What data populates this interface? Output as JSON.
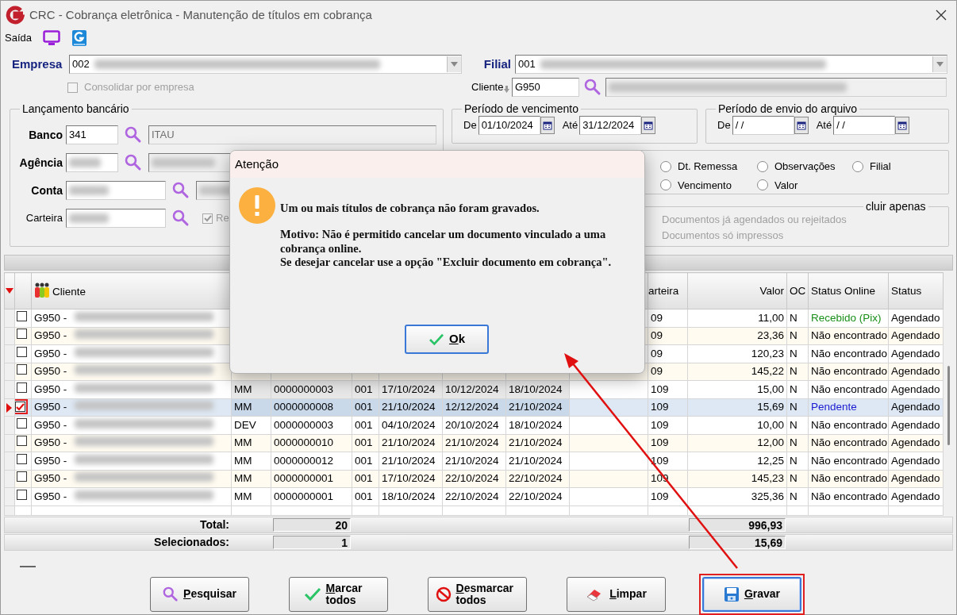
{
  "window": {
    "title": "CRC - Cobrança eletrônica - Manutenção de títulos em cobrança"
  },
  "toolbar": {
    "label": "Saída"
  },
  "empresa": {
    "label": "Empresa",
    "value": "002",
    "redacted": true
  },
  "filial": {
    "label": "Filial",
    "value": "001",
    "redacted": true
  },
  "consolidar": {
    "label": "Consolidar por empresa",
    "checked": false,
    "disabled": true
  },
  "cliente": {
    "label": "Cliente",
    "value": "G950",
    "redacted": true
  },
  "lancamento": {
    "title": "Lançamento bancário",
    "fields": [
      {
        "label": "Banco",
        "required": true,
        "value": "341",
        "description": "ITAU",
        "kind": "short"
      },
      {
        "label": "Agência",
        "required": true,
        "redacted": true,
        "kind": "short"
      },
      {
        "label": "Conta",
        "required": true,
        "redacted": true,
        "kind": "long"
      },
      {
        "label": "Carteira",
        "required": false,
        "redacted": true,
        "kind": "check",
        "check_label": "Re",
        "checked": true
      }
    ]
  },
  "vencimento": {
    "title": "Período de vencimento",
    "from_label": "De",
    "from": "01/10/2024",
    "to_label": "Até",
    "to": "31/12/2024"
  },
  "envio": {
    "title": "Período de envio do arquivo",
    "from_label": "De",
    "from": "/ /",
    "to_label": "Até",
    "to": "/ /"
  },
  "ordenacao": {
    "options": [
      {
        "label": "Dt. Remessa",
        "selected": false
      },
      {
        "label": "Observações",
        "selected": false
      },
      {
        "label": "Filial",
        "selected": false
      },
      {
        "label": "Vencimento",
        "selected": false
      },
      {
        "label": "Valor",
        "selected": false
      }
    ]
  },
  "incluir": {
    "title": "cluir apenas",
    "options": [
      {
        "label": "Documentos já agendados ou rejeitados",
        "disabled": true
      },
      {
        "label": "Documentos só impressos",
        "disabled": true
      }
    ]
  },
  "table": {
    "columns": [
      "",
      "",
      "Cliente",
      "",
      "",
      "",
      "",
      "",
      "",
      "",
      "arteira",
      "Valor",
      "OC",
      "Status Online",
      "Status"
    ],
    "client_redacted": true,
    "rows": [
      {
        "checked": false,
        "selected": false,
        "cliente": "G950 -",
        "carteira": "09",
        "valor": "11,00",
        "oc": "N",
        "status_online": "Recebido (Pix)",
        "color": "#1a8f1a",
        "status": "Agendado"
      },
      {
        "checked": false,
        "selected": false,
        "cliente": "G950 -",
        "carteira": "09",
        "valor": "23,36",
        "oc": "N",
        "status_online": "Não encontrado",
        "color": "#000000",
        "status": "Agendado"
      },
      {
        "checked": false,
        "selected": false,
        "cliente": "G950 -",
        "carteira": "09",
        "valor": "120,23",
        "oc": "N",
        "status_online": "Não encontrado",
        "color": "#000000",
        "status": "Agendado"
      },
      {
        "checked": false,
        "selected": false,
        "cliente": "G950 -",
        "carteira": "09",
        "valor": "145,22",
        "oc": "N",
        "status_online": "Não encontrado",
        "color": "#000000",
        "status": "Agendado"
      },
      {
        "checked": false,
        "selected": false,
        "cliente": "G950 -",
        "tipo": "MM",
        "documento": "0000000003",
        "filial": "001",
        "data_1": "17/10/2024",
        "data_2": "10/12/2024",
        "data_3": "18/10/2024",
        "carteira": "109",
        "valor": "15,00",
        "oc": "N",
        "status_online": "Não encontrado",
        "color": "#000000",
        "status": "Agendado"
      },
      {
        "checked": true,
        "selected": true,
        "annotated": true,
        "cliente": "G950 -",
        "tipo": "MM",
        "documento": "0000000008",
        "filial": "001",
        "data_1": "21/10/2024",
        "data_2": "12/12/2024",
        "data_3": "21/10/2024",
        "carteira": "109",
        "valor": "15,69",
        "oc": "N",
        "status_online": "Pendente",
        "color": "#1a1ad0",
        "status": "Agendado"
      },
      {
        "checked": false,
        "selected": false,
        "cliente": "G950 -",
        "tipo": "DEV",
        "documento": "0000000003",
        "filial": "001",
        "data_1": "04/10/2024",
        "data_2": "20/10/2024",
        "data_3": "18/10/2024",
        "carteira": "109",
        "valor": "10,00",
        "oc": "N",
        "status_online": "Não encontrado",
        "color": "#000000",
        "status": "Agendado"
      },
      {
        "checked": false,
        "selected": false,
        "cliente": "G950 -",
        "tipo": "MM",
        "documento": "0000000010",
        "filial": "001",
        "data_1": "21/10/2024",
        "data_2": "21/10/2024",
        "data_3": "21/10/2024",
        "carteira": "109",
        "valor": "12,00",
        "oc": "N",
        "status_online": "Não encontrado",
        "color": "#000000",
        "status": "Agendado"
      },
      {
        "checked": false,
        "selected": false,
        "cliente": "G950 -",
        "tipo": "MM",
        "documento": "0000000012",
        "filial": "001",
        "data_1": "21/10/2024",
        "data_2": "21/10/2024",
        "data_3": "21/10/2024",
        "carteira": "109",
        "valor": "12,25",
        "oc": "N",
        "status_online": "Não encontrado",
        "color": "#000000",
        "status": "Agendado"
      },
      {
        "checked": false,
        "selected": false,
        "cliente": "G950 -",
        "tipo": "MM",
        "documento": "0000000001",
        "filial": "001",
        "data_1": "17/10/2024",
        "data_2": "22/10/2024",
        "data_3": "22/10/2024",
        "carteira": "109",
        "valor": "145,23",
        "oc": "N",
        "status_online": "Não encontrado",
        "color": "#000000",
        "status": "Agendado"
      },
      {
        "checked": false,
        "selected": false,
        "cliente": "G950 -",
        "tipo": "MM",
        "documento": "0000000001",
        "filial": "001",
        "data_1": "18/10/2024",
        "data_2": "22/10/2024",
        "data_3": "22/10/2024",
        "carteira": "109",
        "valor": "325,36",
        "oc": "N",
        "status_online": "Não encontrado",
        "color": "#000000",
        "status": "Agendado"
      }
    ]
  },
  "totals": [
    {
      "label": "Total:",
      "count": "20",
      "value": "996,93"
    },
    {
      "label": "Selecionados:",
      "count": "1",
      "value": "15,69"
    }
  ],
  "buttons": [
    {
      "label": "Pesquisar",
      "kind": "search",
      "focused": false
    },
    {
      "label": "Marcar todos",
      "kind": "check",
      "focused": false
    },
    {
      "label": "Desmarcar todos",
      "kind": "uncheck",
      "focused": false
    },
    {
      "label": "Limpar",
      "kind": "clear",
      "focused": false
    },
    {
      "label": "Gravar",
      "kind": "save",
      "focused": true,
      "annotated": true
    }
  ],
  "dialog": {
    "title": "Atenção",
    "messages": [
      "Um ou mais títulos de cobrança não foram gravados.",
      "Motivo: Não é permitido cancelar um documento vinculado a uma cobrança online.",
      "Se desejar cancelar use a opção \"Excluir documento em cobrança\"."
    ],
    "button": "Ok"
  }
}
